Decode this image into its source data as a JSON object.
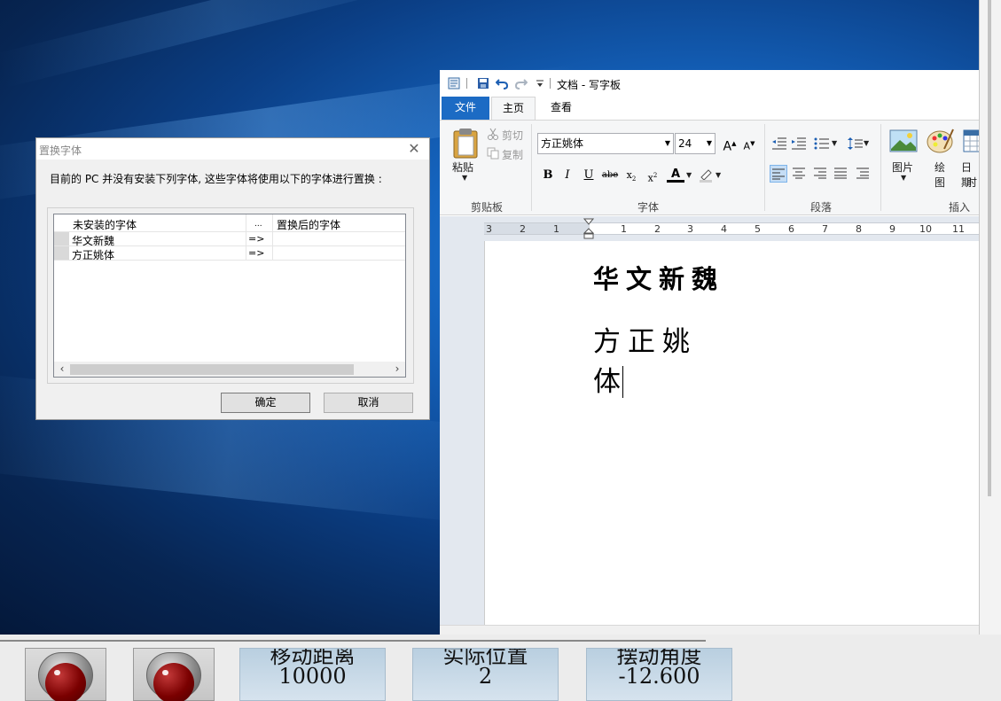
{
  "wordpad": {
    "title": "文档 - 写字板",
    "tabs": [
      "文件",
      "主页",
      "查看"
    ],
    "clipboard": {
      "paste": "粘贴",
      "cut": "剪切",
      "copy": "复制",
      "group_label": "剪贴板"
    },
    "font": {
      "family": "方正姚体",
      "size": "24",
      "group_label": "字体"
    },
    "paragraph": {
      "group_label": "段落"
    },
    "insert": {
      "picture": "图片",
      "paint_line1": "绘",
      "paint_line2": "图",
      "datetime_line1": "日期",
      "datetime_line2": "时",
      "group_label": "插入"
    },
    "ruler_labels": [
      "3",
      "2",
      "1",
      "1",
      "2",
      "3",
      "4",
      "5",
      "6",
      "7",
      "8",
      "9",
      "10",
      "11"
    ],
    "document": {
      "line1": "华文新魏",
      "line2": "方正姚体"
    }
  },
  "dialog": {
    "title": "置换字体",
    "message": "目前的 PC 并没有安装下列字体, 这些字体将使用以下的字体进行置换 :",
    "columns": {
      "missing": "未安装的字体",
      "dots": "...",
      "replacement": "置换后的字体"
    },
    "rows": [
      {
        "font": "华文新魏",
        "arrow": "=>"
      },
      {
        "font": "方正姚体",
        "arrow": "=>"
      }
    ],
    "ok": "确定",
    "cancel": "取消"
  },
  "hmi": {
    "readouts": [
      {
        "label": "移动距离",
        "value": "10000"
      },
      {
        "label": "实际位置",
        "value": "2"
      },
      {
        "label": "摆动角度",
        "value": "-12.600"
      }
    ]
  }
}
